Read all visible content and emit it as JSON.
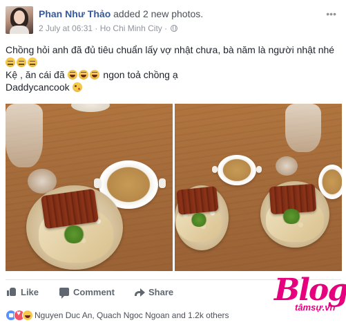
{
  "post": {
    "author": "Phan Như Thảo",
    "action": "added 2 new photos.",
    "date": "2 July at 06:31",
    "separator": "·",
    "location": "Ho Chi Minh City",
    "separator2": "·",
    "options_icon": "ellipsis-icon",
    "text": {
      "line1": "Chồng hỏi anh đã đủ tiêu chuẩn lấy vợ nhật chưa, bà năm là người nhật nhé",
      "line3_a": "Kệ , ăn cái đã",
      "line3_b": "ngon toả chồng ạ",
      "line4": "Daddycancook"
    }
  },
  "actions": {
    "like": "Like",
    "comment": "Comment",
    "share": "Share"
  },
  "reactions": {
    "icons": [
      "like-icon",
      "love-icon",
      "haha-icon"
    ],
    "summary": "Nguyen Duc An, Quach Ngoc Ngoan and 1.2k others"
  },
  "watermark": {
    "main": "Blog",
    "sub": "tâmsự.vn"
  },
  "colors": {
    "link": "#365899",
    "meta": "#90949c",
    "watermark": "#e6007e"
  }
}
